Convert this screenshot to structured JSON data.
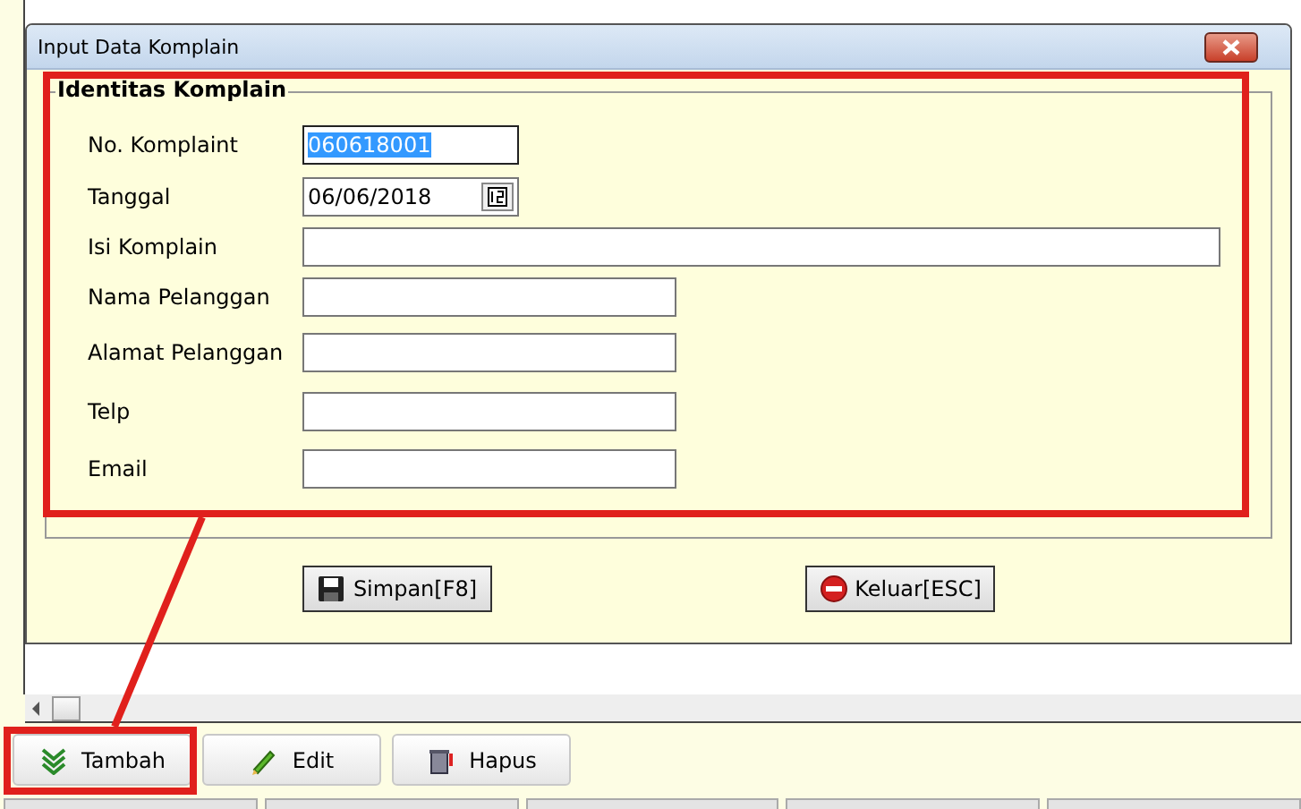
{
  "window": {
    "title": "Input Data Komplain"
  },
  "group": {
    "title": "Identitas Komplain",
    "highlighted": true
  },
  "fields": [
    {
      "label": "No. Komplaint",
      "kind": "code",
      "value": "060618001",
      "text_selected": true
    },
    {
      "label": "Tanggal",
      "kind": "date",
      "value": "06/06/2018",
      "text_selected": false
    },
    {
      "label": "Isi Komplain",
      "kind": "wide",
      "text_selected": false
    },
    {
      "label": "Nama Pelanggan",
      "kind": "text",
      "text_selected": false
    },
    {
      "label": "Alamat Pelanggan",
      "kind": "text",
      "text_selected": false
    },
    {
      "label": "Telp",
      "kind": "text",
      "text_selected": false
    },
    {
      "label": "Email",
      "kind": "text",
      "text_selected": false
    }
  ],
  "dialog_buttons": [
    {
      "label": "Simpan[F8]",
      "kind": "save"
    },
    {
      "label": "Keluar[ESC]",
      "kind": "exit"
    }
  ],
  "toolbar_buttons": [
    {
      "label": "Tambah",
      "kind": "add",
      "highlighted": true
    },
    {
      "label": "Edit",
      "kind": "edit",
      "highlighted": false
    },
    {
      "label": "Hapus",
      "kind": "delete",
      "highlighted": false
    }
  ]
}
